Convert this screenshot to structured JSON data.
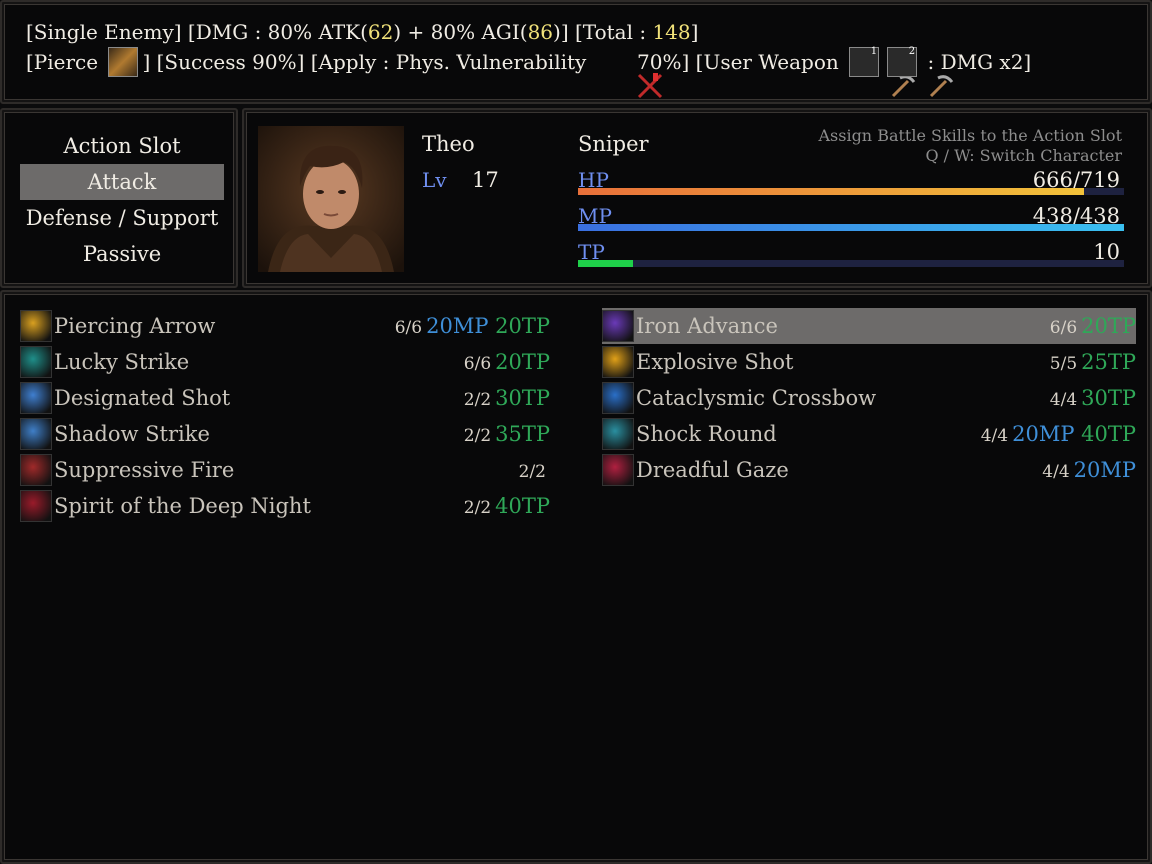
{
  "help": {
    "line1": {
      "a": "[Single Enemy] [DMG : 80% ATK(",
      "atk": "62",
      "b": ") + 80% AGI(",
      "agi": "86",
      "c": ")] [Total : ",
      "total": "148",
      "d": "]"
    },
    "line2": {
      "a": "[Pierce ",
      "b": "] [Success 90%] [Apply : Phys. Vulnerability ",
      "c": " 70%] [User Weapon ",
      "w1": "1",
      "w2": "2",
      "d": " : DMG x2]"
    }
  },
  "slots": [
    "Action Slot",
    "Attack",
    "Defense / Support",
    "Passive"
  ],
  "selected_slot": "Attack",
  "character": {
    "name": "Theo",
    "lv_label": "Lv",
    "level": "17",
    "class": "Sniper",
    "hint1": "Assign Battle Skills to the Action Slot",
    "hint2": "Q / W: Switch Character",
    "hp_label": "HP",
    "hp": "666/719",
    "hp_ratio": 0.926,
    "mp_label": "MP",
    "mp": "438/438",
    "mp_ratio": 1.0,
    "tp_label": "TP",
    "tp": "10",
    "tp_ratio": 0.1
  },
  "skills_left": [
    {
      "name": "Piercing Arrow",
      "uses": "6/6",
      "mp": "20MP",
      "tp": "20TP",
      "icon": "piercing-arrow-icon",
      "color": "#d9a020"
    },
    {
      "name": "Lucky Strike",
      "uses": "6/6",
      "mp": "",
      "tp": "20TP",
      "icon": "lucky-strike-icon",
      "color": "#1f8f8a"
    },
    {
      "name": "Designated Shot",
      "uses": "2/2",
      "mp": "",
      "tp": "30TP",
      "icon": "designated-shot-icon",
      "color": "#3f7fd0"
    },
    {
      "name": "Shadow Strike",
      "uses": "2/2",
      "mp": "",
      "tp": "35TP",
      "icon": "shadow-strike-icon",
      "color": "#3f7fc8"
    },
    {
      "name": "Suppressive Fire",
      "uses": "2/2",
      "mp": "",
      "tp": "",
      "icon": "suppressive-fire-icon",
      "color": "#a02a2a"
    },
    {
      "name": "Spirit of the Deep Night",
      "uses": "2/2",
      "mp": "",
      "tp": "40TP",
      "icon": "spirit-deep-night-icon",
      "color": "#9a1b2a"
    }
  ],
  "skills_right": [
    {
      "name": "Iron Advance",
      "uses": "6/6",
      "mp": "",
      "tp": "20TP",
      "icon": "iron-advance-icon",
      "color": "#6a3ab8"
    },
    {
      "name": "Explosive Shot",
      "uses": "5/5",
      "mp": "",
      "tp": "25TP",
      "icon": "explosive-shot-icon",
      "color": "#e0a018"
    },
    {
      "name": "Cataclysmic Crossbow",
      "uses": "4/4",
      "mp": "",
      "tp": "30TP",
      "icon": "cataclysmic-crossbow-icon",
      "color": "#2a6fc8"
    },
    {
      "name": "Shock Round",
      "uses": "4/4",
      "mp": "20MP",
      "tp": "40TP",
      "icon": "shock-round-icon",
      "color": "#2a8fa0"
    },
    {
      "name": "Dreadful Gaze",
      "uses": "4/4",
      "mp": "20MP",
      "tp": "",
      "icon": "dreadful-gaze-icon",
      "color": "#b02040"
    }
  ],
  "selected_skill": "Iron Advance",
  "colors": {
    "hp_start": "#e8703a",
    "hp_end": "#f2c23a",
    "mp_start": "#3a6fe0",
    "mp_end": "#3ac0f0",
    "tp": "#1fd04a",
    "mp_text": "#3f8fd8",
    "tp_text": "#2fa858"
  }
}
